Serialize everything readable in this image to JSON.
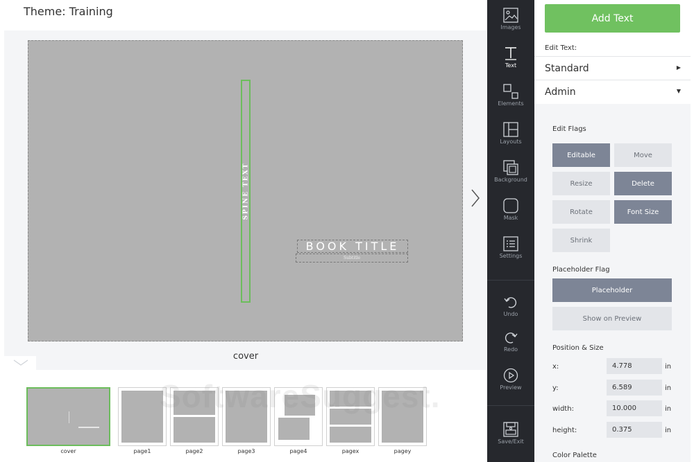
{
  "theme_title": "Theme: Training",
  "canvas": {
    "spine_text": "SPINE TEXT",
    "book_title": "BOOK TITLE",
    "subtitle": "Subtitle",
    "page_label": "cover"
  },
  "thumbnails": [
    {
      "label": "cover"
    },
    {
      "label": "page1"
    },
    {
      "label": "page2"
    },
    {
      "label": "page3"
    },
    {
      "label": "page4"
    },
    {
      "label": "pagex"
    },
    {
      "label": "pagey"
    }
  ],
  "watermark": "SoftwareSuggest.",
  "rail": {
    "images": "Images",
    "text": "Text",
    "elements": "Elements",
    "layouts": "Layouts",
    "background": "Background",
    "mask": "Mask",
    "settings": "Settings",
    "undo": "Undo",
    "redo": "Redo",
    "preview": "Preview",
    "save_exit": "Save/Exit"
  },
  "panel": {
    "add_text": "Add Text",
    "edit_text_label": "Edit Text:",
    "standard": "Standard",
    "admin": "Admin",
    "edit_flags_label": "Edit Flags",
    "flags": {
      "editable": "Editable",
      "move": "Move",
      "resize": "Resize",
      "delete": "Delete",
      "rotate": "Rotate",
      "font_size": "Font Size",
      "shrink": "Shrink"
    },
    "placeholder_flag_label": "Placeholder Flag",
    "placeholder": "Placeholder",
    "show_on_preview": "Show on Preview",
    "position_size_label": "Position & Size",
    "position": {
      "x_label": "x:",
      "x_value": "4.778",
      "y_label": "y:",
      "y_value": "6.589",
      "width_label": "width:",
      "width_value": "10.000",
      "height_label": "height:",
      "height_value": "0.375",
      "unit": "in"
    },
    "color_palette_label": "Color Palette"
  },
  "colors": {
    "accent_green": "#70c160",
    "rail_bg": "#26282d",
    "flag_on": "#7d8596",
    "flag_off": "#e3e5e9"
  }
}
